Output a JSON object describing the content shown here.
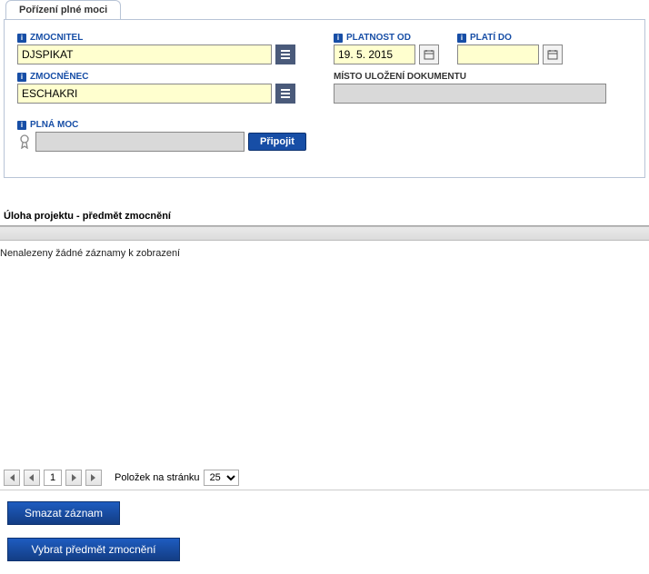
{
  "tab_title": "Pořízení plné moci",
  "fields": {
    "zmocnitel": {
      "label": "ZMOCNITEL",
      "value": "DJSPIKAT"
    },
    "zmocnenec": {
      "label": "ZMOCNĚNEC",
      "value": "ESCHAKRI"
    },
    "plna_moc": {
      "label": "PLNÁ MOC",
      "value": ""
    },
    "platnost_od": {
      "label": "PLATNOST OD",
      "value": "19. 5. 2015"
    },
    "plati_do": {
      "label": "PLATÍ DO",
      "value": ""
    },
    "misto_ulozeni": {
      "label": "MÍSTO ULOŽENÍ DOKUMENTU",
      "value": ""
    }
  },
  "buttons": {
    "pripojit": "Připojit",
    "smazat": "Smazat záznam",
    "vybrat": "Vybrat předmět zmocnění"
  },
  "section": {
    "title": "Úloha projektu - předmět zmocnění",
    "empty": "Nenalezeny žádné záznamy k zobrazení"
  },
  "pager": {
    "page": "1",
    "label": "Položek na stránku",
    "size": "25"
  }
}
